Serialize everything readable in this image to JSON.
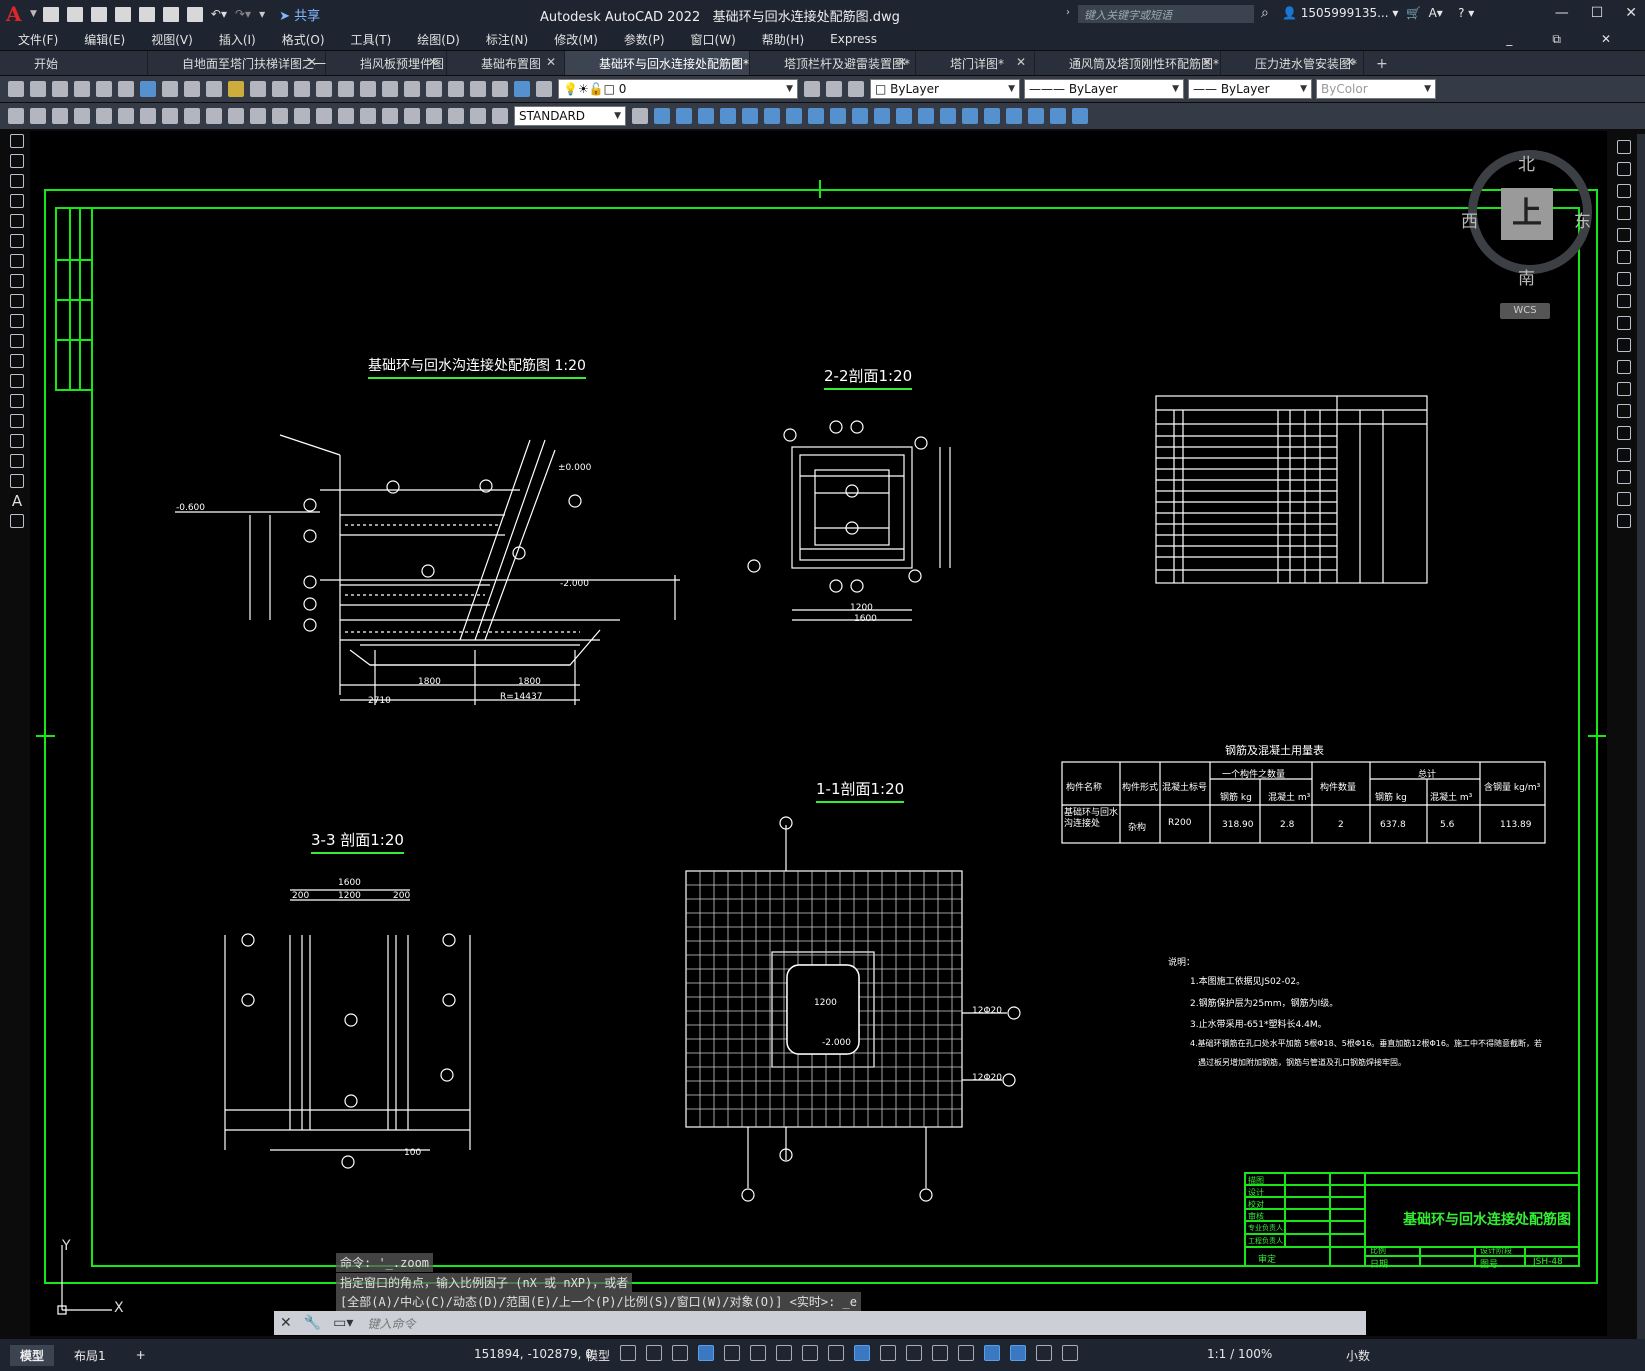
{
  "app": {
    "title": "Autodesk AutoCAD 2022",
    "file": "基础环与回水连接处配筋图.dwg",
    "share": "共享",
    "search_placeholder": "键入关键字或短语",
    "user": "1505999135...",
    "logo": "A"
  },
  "menu": [
    "文件(F)",
    "编辑(E)",
    "视图(V)",
    "插入(I)",
    "格式(O)",
    "工具(T)",
    "绘图(D)",
    "标注(N)",
    "修改(M)",
    "参数(P)",
    "窗口(W)",
    "帮助(H)",
    "Express"
  ],
  "tabs": [
    {
      "label": "开始",
      "closable": false
    },
    {
      "label": "自地面至塔门扶梯详图之一",
      "closable": true
    },
    {
      "label": "挡风板预埋件图",
      "closable": true
    },
    {
      "label": "基础布置图",
      "closable": true
    },
    {
      "label": "基础环与回水连接处配筋图*",
      "closable": true,
      "active": true
    },
    {
      "label": "塔顶栏杆及避雷装置图*",
      "closable": true
    },
    {
      "label": "塔门详图*",
      "closable": true
    },
    {
      "label": "通风筒及塔顶刚性环配筋图*",
      "closable": true
    },
    {
      "label": "压力进水管安装图*",
      "closable": true
    }
  ],
  "toolbar": {
    "layer": "0",
    "color": "ByLayer",
    "linetype": "ByLayer",
    "lineweight": "ByLayer",
    "plotstyle": "ByColor",
    "textstyle": "STANDARD"
  },
  "viewcube": {
    "north": "北",
    "south": "南",
    "east": "东",
    "west": "西",
    "top": "上",
    "wcs": "WCS"
  },
  "drawing": {
    "title_main": "基础环与回水沟连接处配筋图  1:20",
    "title_22": "2-2剖面1:20",
    "title_11": "1-1剖面1:20",
    "title_33": "3-3 剖面1:20",
    "table_title": "钢筋及混凝土用量表",
    "table_headers": [
      "构件名称",
      "构件形式",
      "混凝土标号",
      "一个构件之数量",
      "钢筋 kg",
      "混凝土 m³",
      "构件数量",
      "总计",
      "钢筋 kg",
      "混凝土 m³",
      "含钢量 kg/m³"
    ],
    "table_row": [
      "基础环与回水沟连接处",
      "杂构",
      "R200",
      "318.90",
      "2.8",
      "2",
      "637.8",
      "5.6",
      "113.89"
    ],
    "notes_title": "说明：",
    "notes": [
      "1.本图施工依据见JS02-02。",
      "2.钢筋保护层为25mm，钢筋为I级。",
      "3.止水带采用-651*塑料长4.4M。",
      "4.基础环钢筋在孔口处水平加筋 5根Φ18、5根Φ16。垂直加筋12根Φ16。施工中不得随意截断，若",
      "遇过板另增加附加钢筋，钢筋与管道及孔口钢筋焊接牢固。"
    ],
    "titleblock_name": "基础环与回水连接处配筋图",
    "titleblock_rows": [
      "描图",
      "设计",
      "校对",
      "审核",
      "专业负责人",
      "工程负责人"
    ],
    "titleblock_bottom": [
      "审定",
      "日期",
      "图号"
    ],
    "titleblock_ratio": "比例",
    "titleblock_stage": "设计阶段",
    "titleblock_no": "JSH-48",
    "dims": {
      "d1600": "1600",
      "d1200": "1200",
      "d200": "200",
      "d2710": "2710",
      "r": "R=14437",
      "e0": "±0.000",
      "e2": "-2.000",
      "e06": "-0.600",
      "d100": "100",
      "d1800": "1800",
      "d12020": "12Φ20"
    }
  },
  "command": {
    "history": [
      "命令: '_.zoom",
      "指定窗口的角点，输入比例因子 (nX 或 nXP)，或者",
      "[全部(A)/中心(C)/动态(D)/范围(E)/上一个(P)/比例(S)/窗口(W)/对象(O)] <实时>: _e"
    ],
    "placeholder": "键入命令"
  },
  "status": {
    "tab_model": "模型",
    "tab_layout": "布局1",
    "plus": "+",
    "coords": "151894, -102879, 0",
    "space": "模型",
    "scale": "1:1 / 100%",
    "units": "小数"
  }
}
